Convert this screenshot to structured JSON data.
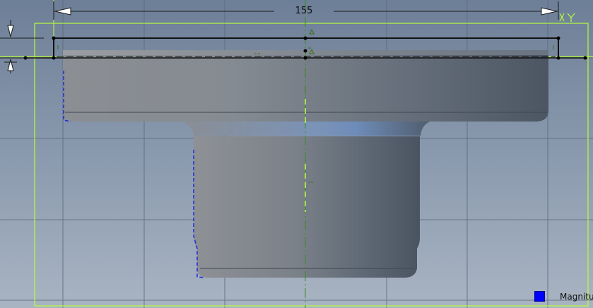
{
  "viewport": {
    "background_top": "#6d7f97",
    "background_bottom": "#a9b4c2",
    "grid_color": "#5b6b7e",
    "sketch_frame_color": "#b6ff3a",
    "centerline_color": "#3a8a20",
    "dimension_line_color": "#1a1a1a",
    "constraint_color": "#3c6e1e",
    "hidden_edge_color": "#1f2bd6"
  },
  "dimension": {
    "value": "155",
    "arrow_icon": "arrowhead-icon"
  },
  "axis": {
    "label_icon": "xy-plane-icon"
  },
  "part": {
    "shade_light": "#8c8f94",
    "shade_dark": "#4a5563",
    "highlight": "#7ea6d8"
  },
  "legend": {
    "swatch_color": "#0000ff",
    "label": "Magnitu"
  }
}
